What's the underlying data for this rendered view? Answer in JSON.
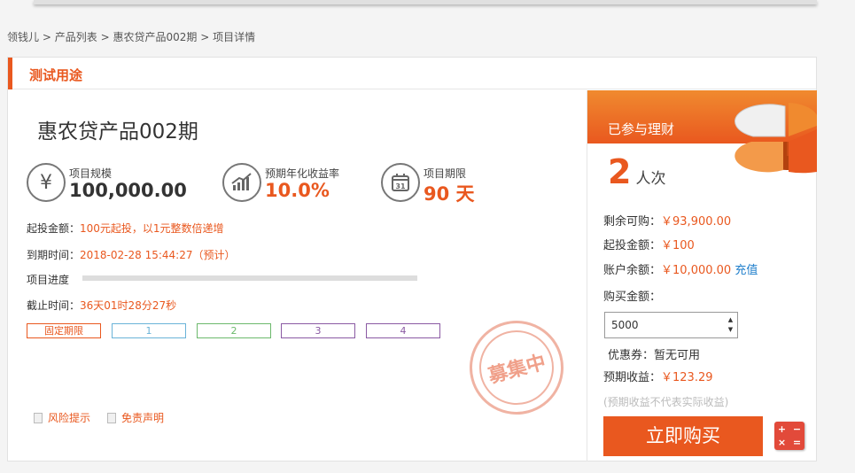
{
  "breadcrumb": {
    "items": [
      "领钱儿",
      "产品列表",
      "惠农贷产品002期",
      "项目详情"
    ],
    "separator": ">"
  },
  "card": {
    "section_title": "测试用途"
  },
  "product": {
    "title": "惠农贷产品002期",
    "stats": [
      {
        "icon": "yen-icon",
        "label": "项目规模",
        "value": "100,000.00"
      },
      {
        "icon": "chart-growth-icon",
        "label": "预期年化收益率",
        "value": "10.0%"
      },
      {
        "icon": "calendar-icon",
        "label": "项目期限",
        "value": "90 天"
      }
    ],
    "min_invest": {
      "label": "起投金额：",
      "value": "100元起投，以1元整数倍递增"
    },
    "due_time": {
      "label": "到期时间：",
      "value": "2018-02-28 15:44:27（预计）"
    },
    "progress": {
      "label": "项目进度",
      "percent": 0
    },
    "deadline": {
      "label": "截止时间：",
      "value": "36天01时28分27秒"
    },
    "tags": [
      {
        "text": "固定期限",
        "color": "#e9581f"
      },
      {
        "text": "1",
        "color": "#6ab3d8"
      },
      {
        "text": "2",
        "color": "#6cb96c"
      },
      {
        "text": "3",
        "color": "#8a5aa3"
      },
      {
        "text": "4",
        "color": "#8a5aa3"
      }
    ],
    "links": {
      "risk": "风险提示",
      "disclaimer": "免责声明"
    },
    "stamp_text": "募集中"
  },
  "purchase": {
    "banner_text": "已参与理财",
    "participants": {
      "count": "2",
      "unit": "人次"
    },
    "remaining": {
      "label": "剩余可购：",
      "value": "￥93,900.00"
    },
    "min_invest": {
      "label": "起投金额：",
      "value": "￥100"
    },
    "balance": {
      "label": "账户余额：",
      "value": "￥10,000.00",
      "action": "充值"
    },
    "amount_label": "购买金额：",
    "amount_value": "5000",
    "coupon": {
      "label": "优惠券：",
      "value": "暂无可用"
    },
    "expected": {
      "label": "预期收益：",
      "value": "￥123.29"
    },
    "note": "(预期收益不代表实际收益)",
    "buy_button": "立即购买"
  },
  "colors": {
    "accent": "#e9581f",
    "link": "#1e7ecb"
  }
}
